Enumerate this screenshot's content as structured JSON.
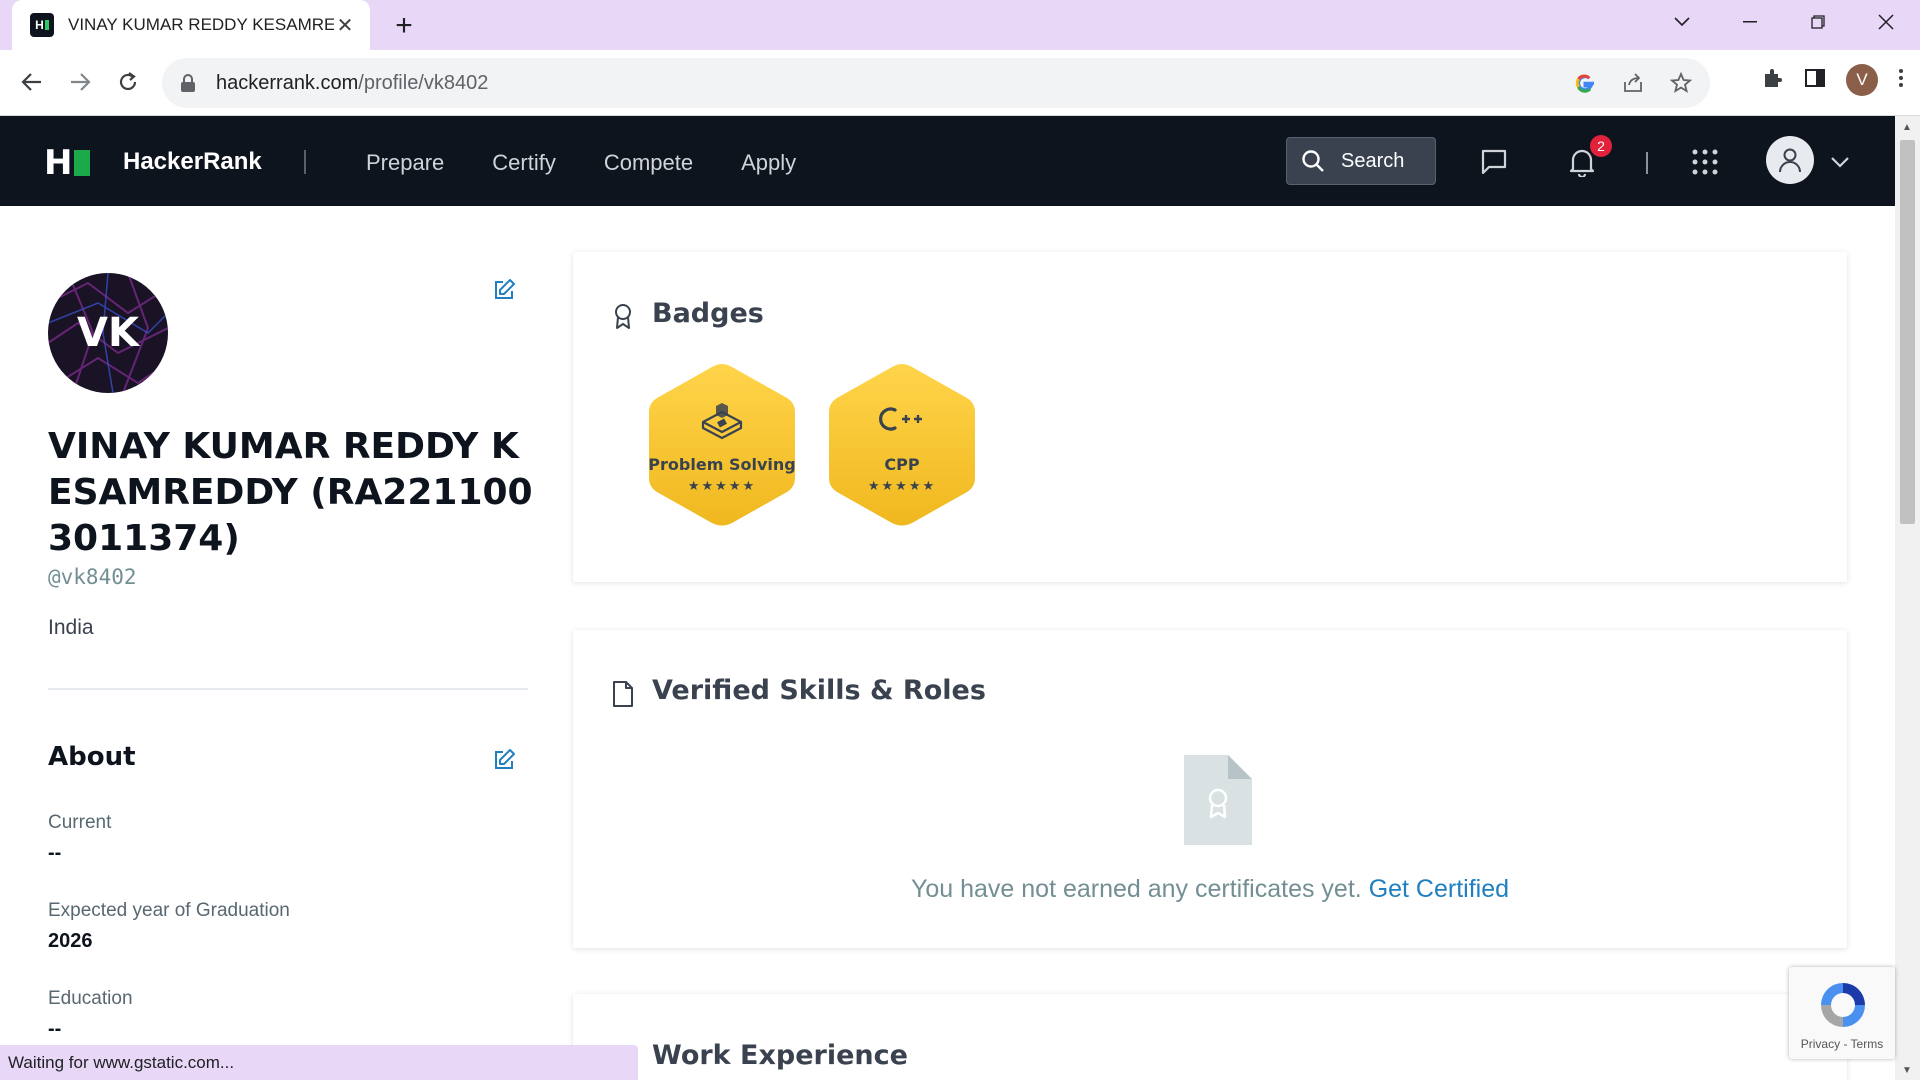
{
  "browser": {
    "tab_title": "VINAY KUMAR REDDY KESAMREDDY",
    "url_host": "hackerrank.com",
    "url_path": "/profile/vk8402",
    "profile_initial": "V",
    "status_text": "Waiting for www.gstatic.com..."
  },
  "header": {
    "brand": "HackerRank",
    "nav": [
      "Prepare",
      "Certify",
      "Compete",
      "Apply"
    ],
    "search_label": "Search",
    "notification_count": "2"
  },
  "profile": {
    "initials": "VK",
    "name": "VINAY KUMAR REDDY KESAMREDDY (RA2211003011374)",
    "handle": "@vk8402",
    "country": "India"
  },
  "about": {
    "title": "About",
    "fields": [
      {
        "label": "Current",
        "value": "--"
      },
      {
        "label": "Expected year of Graduation",
        "value": "2026"
      },
      {
        "label": "Education",
        "value": "--"
      }
    ]
  },
  "badges": {
    "title": "Badges",
    "items": [
      {
        "name": "Problem Solving",
        "stars": "★★★★★",
        "icon": "puzzle-cube-icon",
        "color": "#f6c62c"
      },
      {
        "name": "CPP",
        "stars": "★★★★★",
        "icon": "cpp-icon",
        "color": "#f6c62c"
      }
    ]
  },
  "skills": {
    "title": "Verified Skills & Roles",
    "empty_text": "You have not earned any certificates yet.",
    "cta": "Get Certified"
  },
  "work": {
    "title": "Work Experience"
  },
  "recaptcha": {
    "links": "Privacy - Terms"
  },
  "colors": {
    "header_bg": "#0e141e",
    "brand_green": "#1ba94c",
    "link_blue": "#1f7fc1",
    "badge_gold": "#f6c62c",
    "tabstrip": "#e8d7f7"
  }
}
